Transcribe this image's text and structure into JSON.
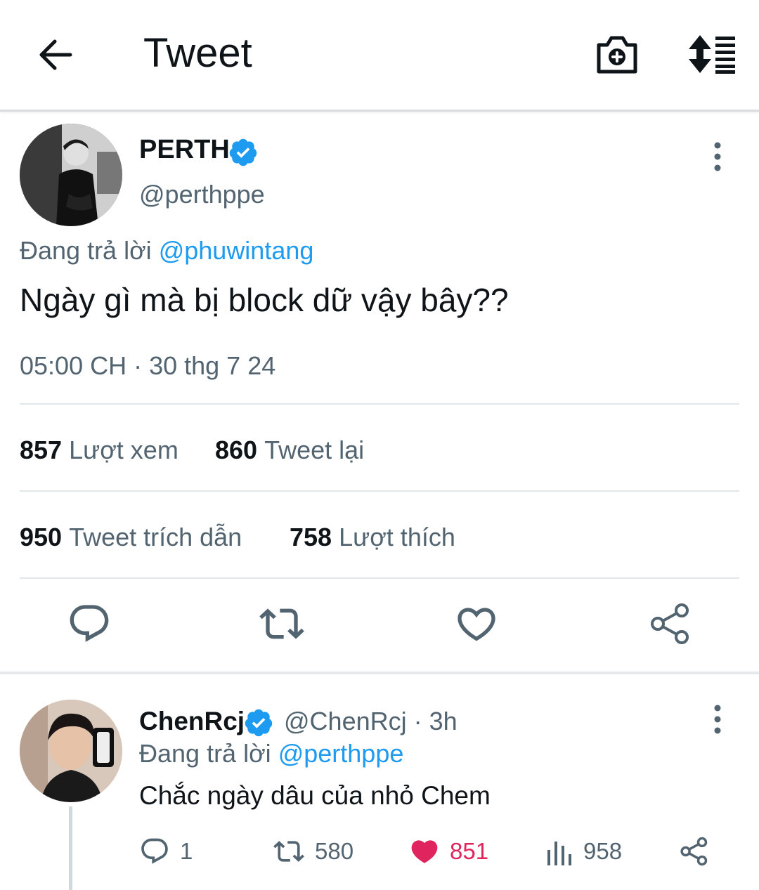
{
  "header": {
    "title": "Tweet",
    "icons": [
      "back-arrow-icon",
      "camera-plus-icon",
      "sort-list-icon"
    ]
  },
  "tweet": {
    "display_name": "PERTH",
    "handle": "@perthppe",
    "replying_prefix": "Đang trả lời",
    "replying_to": "@phuwintang",
    "text": "Ngày gì mà bị block dữ vậy bây??",
    "timestamp": "05:00 CH · 30 thg 7 24",
    "stats": {
      "views_count": "857",
      "views_label": "Lượt xem",
      "retweets_count": "860",
      "retweets_label": "Tweet lại",
      "quotes_count": "950",
      "quotes_label": "Tweet trích dẫn",
      "likes_count": "758",
      "likes_label": "Lượt thích"
    },
    "actions": [
      "reply-icon",
      "retweet-icon",
      "like-icon",
      "share-icon"
    ]
  },
  "reply": {
    "display_name": "ChenRcj",
    "meta": "@ChenRcj · 3h",
    "replying_prefix": "Đang trả lời",
    "replying_to": "@perthppe",
    "text": "Chắc ngày dâu của nhỏ Chem",
    "reply_count": "1",
    "retweet_count": "580",
    "like_count": "851",
    "view_count": "958",
    "liked": true
  },
  "colors": {
    "accent": "#1d9bf0",
    "like": "#e0245e",
    "secondary_text": "#536471",
    "primary_text": "#0f1419"
  }
}
